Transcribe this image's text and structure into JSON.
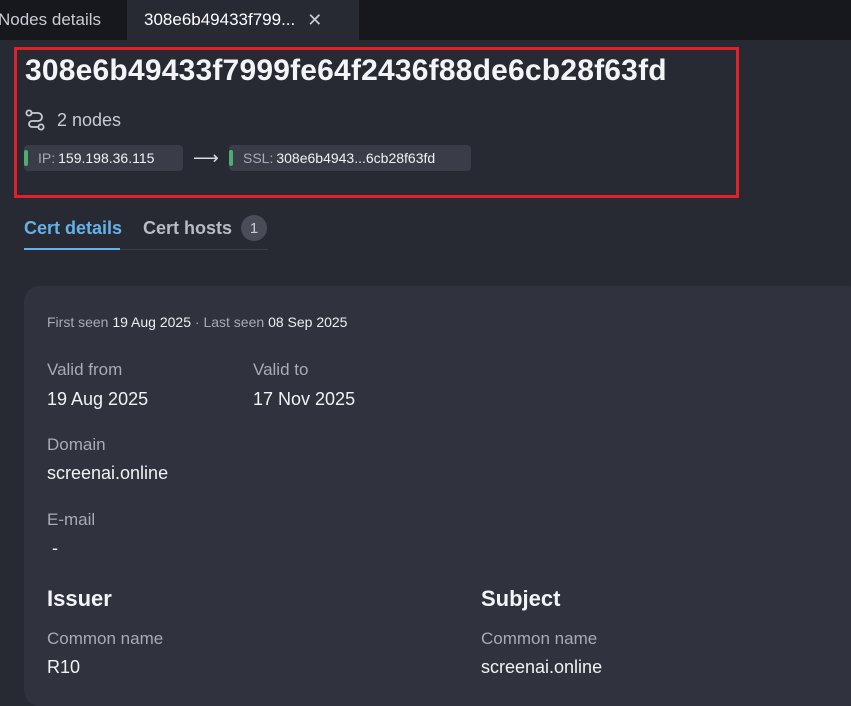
{
  "tabs": [
    {
      "label": "Nodes details"
    },
    {
      "label": "308e6b49433f799..."
    }
  ],
  "close_icon_glyph": "✕",
  "header": {
    "title": "308e6b49433f7999fe64f2436f88de6cb28f63fd",
    "nodes_count": "2 nodes",
    "ip_key": "IP:",
    "ip_value": "159.198.36.115",
    "arrow": "⟶",
    "ssl_key": "SSL:",
    "ssl_value": "308e6b4943...6cb28f63fd"
  },
  "subtabs": {
    "cert_details": "Cert details",
    "cert_hosts": "Cert hosts",
    "cert_hosts_count": "1"
  },
  "details": {
    "first_seen_label": "First seen",
    "first_seen": "19 Aug 2025",
    "separator": "·",
    "last_seen_label": "Last seen",
    "last_seen": "08 Sep 2025",
    "valid_from_label": "Valid from",
    "valid_from": "19 Aug 2025",
    "valid_to_label": "Valid to",
    "valid_to": "17 Nov 2025",
    "domain_label": "Domain",
    "domain": "screenai.online",
    "email_label": "E-mail",
    "email": "-",
    "issuer_title": "Issuer",
    "issuer_cn_label": "Common name",
    "issuer_cn": "R10",
    "subject_title": "Subject",
    "subject_cn_label": "Common name",
    "subject_cn": "screenai.online"
  },
  "colors": {
    "accent": "#66b1e6",
    "status_green": "#4fae6f",
    "highlight": "#e0202a"
  }
}
